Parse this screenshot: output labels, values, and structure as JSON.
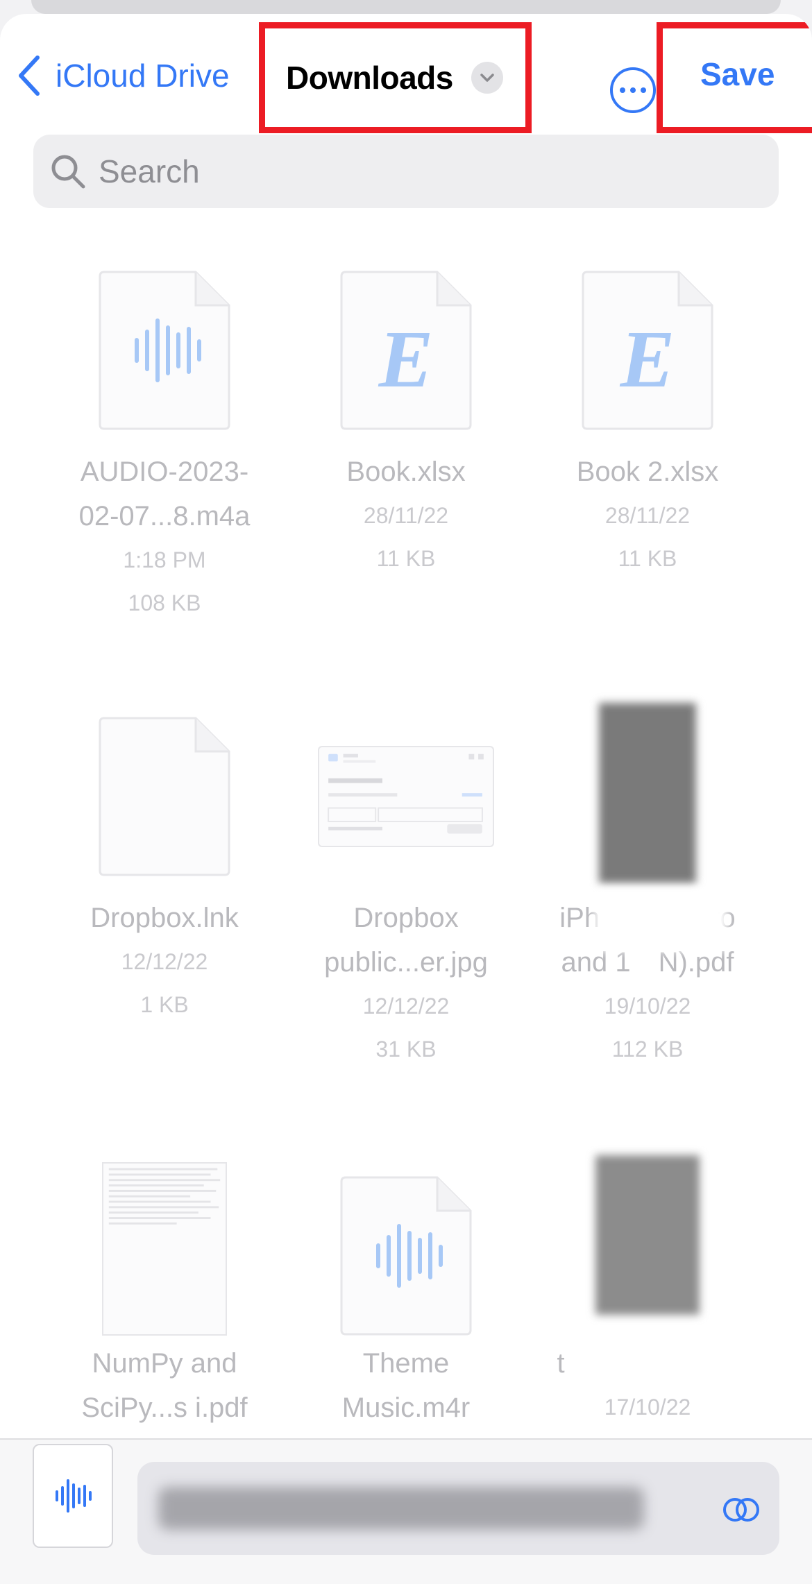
{
  "nav": {
    "back_label": "iCloud Drive",
    "title": "Downloads",
    "save_label": "Save",
    "accent": "#3478f6",
    "highlight": "#ec1c24"
  },
  "search": {
    "placeholder": "Search"
  },
  "files": [
    {
      "name_line1": "AUDIO-2023-",
      "name_line2": "02-07...8.m4a",
      "meta1": "1:18 PM",
      "meta2": "108 KB",
      "icon": "waveform-icon"
    },
    {
      "name_line1": "Book.xlsx",
      "meta1": "28/11/22",
      "meta2": "11 KB",
      "icon": "excel-e-icon"
    },
    {
      "name_line1": "Book 2.xlsx",
      "meta1": "28/11/22",
      "meta2": "11 KB",
      "icon": "excel-e-icon"
    },
    {
      "name_line1": "Dropbox.lnk",
      "meta1": "12/12/22",
      "meta2": "1 KB",
      "icon": "blank-document-icon"
    },
    {
      "name_line1": "Dropbox",
      "name_line2": "public...er.jpg",
      "meta1": "12/12/22",
      "meta2": "31 KB",
      "icon": "image-preview"
    },
    {
      "name_line1": "iPh",
      "name_line1_tail": "ro",
      "name_line2": "and 1",
      "name_line2_tail": "N).pdf",
      "meta1": "19/10/22",
      "meta2": "112 KB",
      "icon": "photo-preview-blurred"
    },
    {
      "name_line1": "NumPy and",
      "name_line2": "SciPy...s i.pdf",
      "icon": "text-document-preview"
    },
    {
      "name_line1": "Theme",
      "name_line2": "Music.m4r",
      "icon": "waveform-icon"
    },
    {
      "name_line1": "t",
      "meta1": "17/10/22",
      "icon": "photo-preview-blurred"
    }
  ],
  "bottom": {
    "file_icon": "waveform-icon"
  }
}
